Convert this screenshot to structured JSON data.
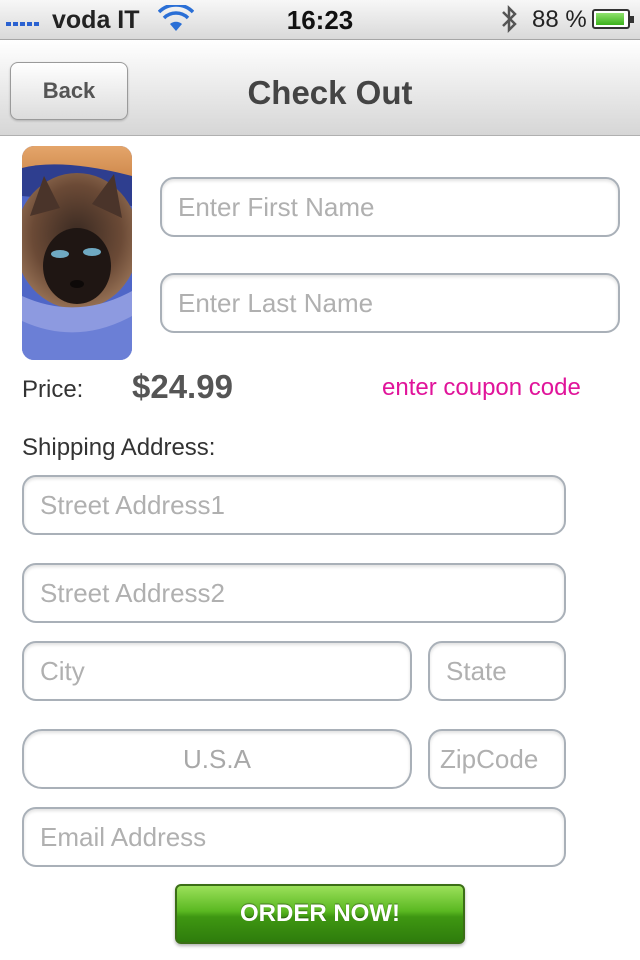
{
  "status_bar": {
    "carrier": "voda IT",
    "time": "16:23",
    "battery_percent": "88 %",
    "battery_level": 0.88,
    "icons": [
      "signal-icon",
      "wifi-icon",
      "bluetooth-icon",
      "battery-icon"
    ]
  },
  "nav": {
    "back_label": "Back",
    "title": "Check Out"
  },
  "form": {
    "first_name_placeholder": "Enter First Name",
    "last_name_placeholder": "Enter Last Name",
    "price_label": "Price:",
    "price_value": "$24.99",
    "coupon_link": "enter coupon code",
    "shipping_label": "Shipping Address:",
    "street1_placeholder": "Street Address1",
    "street2_placeholder": "Street Address2",
    "city_placeholder": "City",
    "state_placeholder": "State",
    "country_placeholder": "U.S.A",
    "zip_placeholder": "ZipCode",
    "email_placeholder": "Email Address",
    "order_button": "ORDER NOW!"
  },
  "colors": {
    "coupon_link": "#e0149a",
    "order_button": "#4ea51a",
    "signal": "#2b62d1"
  }
}
